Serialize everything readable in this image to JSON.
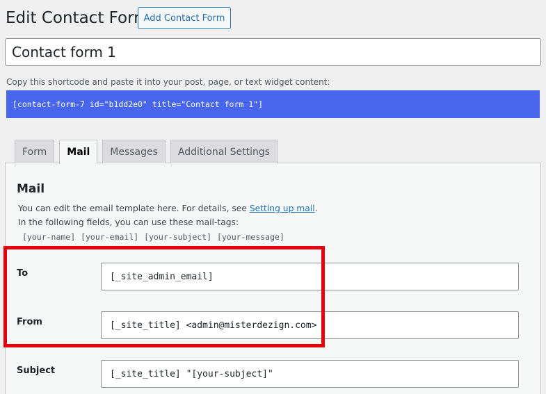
{
  "header": {
    "title": "Edit Contact Form",
    "add_button_label": "Add Contact Form"
  },
  "form_title": "Contact form 1",
  "shortcode": {
    "label": "Copy this shortcode and paste it into your post, page, or text widget content:",
    "code": "[contact-form-7 id=\"b1dd2e0\" title=\"Contact form 1\"]"
  },
  "tabs": [
    {
      "label": "Form",
      "active": false
    },
    {
      "label": "Mail",
      "active": true
    },
    {
      "label": "Messages",
      "active": false
    },
    {
      "label": "Additional Settings",
      "active": false
    }
  ],
  "mail": {
    "heading": "Mail",
    "desc_prefix": "You can edit the email template here. For details, see ",
    "desc_link": "Setting up mail",
    "desc_suffix": ".",
    "desc_line2": "In the following fields, you can use these mail-tags:",
    "mail_tags": "[your-name] [your-email] [your-subject] [your-message]",
    "fields": {
      "to": {
        "label": "To",
        "value": "[_site_admin_email]"
      },
      "from": {
        "label": "From",
        "value": "[_site_title] <admin@misterdezign.com>"
      },
      "subject": {
        "label": "Subject",
        "value": "[_site_title] \"[your-subject]\""
      }
    }
  },
  "colors": {
    "shortcode_bg": "#4766ec",
    "highlight": "#e8000d",
    "accent": "#2271b1"
  }
}
